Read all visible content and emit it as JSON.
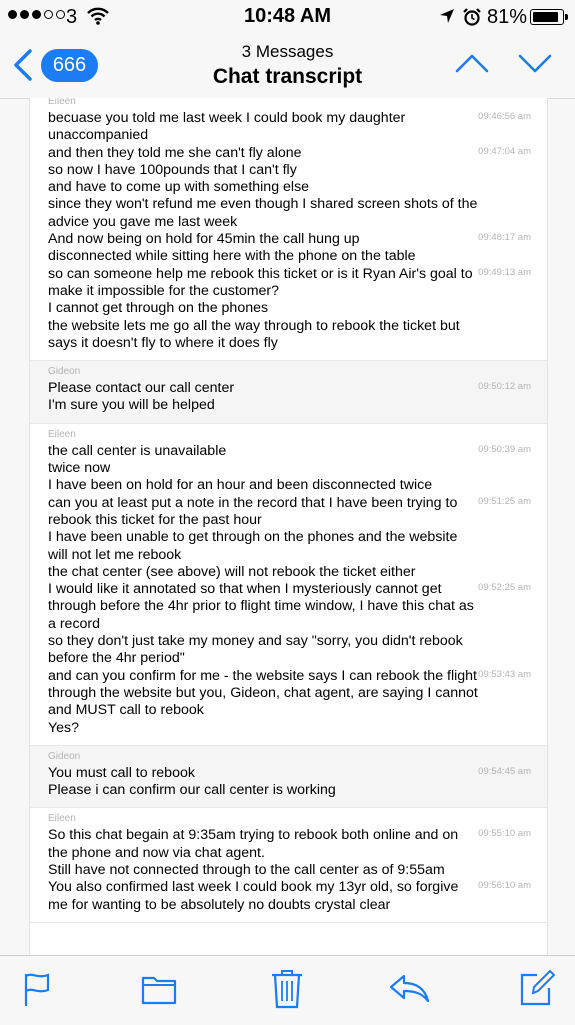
{
  "status_bar": {
    "carrier": "3",
    "time": "10:48 AM",
    "battery": "81%",
    "signal_bars_filled": 3,
    "signal_bars_total": 5
  },
  "nav": {
    "back_count": "666",
    "subtitle": "3 Messages",
    "title": "Chat transcript"
  },
  "colors": {
    "accent": "#1b7cf3"
  },
  "messages": [
    {
      "sender": "Eileen",
      "role": "customer",
      "lines": [
        {
          "text": "becuase you told me last week I could book my daughter unaccompanied",
          "time": "09:46:56 am"
        },
        {
          "text": "and then they told me she can't fly alone",
          "time": "09:47:04 am"
        },
        {
          "text": "so now I have 100pounds that I can't fly",
          "time": ""
        },
        {
          "text": "and have to come up with something else",
          "time": ""
        },
        {
          "text": "since they won't refund me even though I shared screen shots of the advice you gave me last week",
          "time": ""
        },
        {
          "text": "And now being on hold for 45min the call hung up",
          "time": "09:48:17 am"
        },
        {
          "text": "disconnected while sitting here with the phone on the table",
          "time": ""
        },
        {
          "text": "so can someone help me rebook this ticket or is it Ryan Air's goal to make it impossible for the customer?",
          "time": "09:49:13 am"
        },
        {
          "text": "I cannot get through on the phones",
          "time": ""
        },
        {
          "text": "the website lets me go all the way through to rebook the ticket but says it doesn't fly to where it does fly",
          "time": ""
        }
      ]
    },
    {
      "sender": "Gideon",
      "role": "agent",
      "lines": [
        {
          "text": "Please contact our call center",
          "time": "09:50:12 am"
        },
        {
          "text": "I'm sure you will be helped",
          "time": ""
        }
      ]
    },
    {
      "sender": "Eileen",
      "role": "customer",
      "lines": [
        {
          "text": "the call center is unavailable",
          "time": "09:50:39 am"
        },
        {
          "text": "twice now",
          "time": ""
        },
        {
          "text": "I have been on hold for an hour and been disconnected twice",
          "time": ""
        },
        {
          "text": "can you at least put a note in the record that I have been trying to rebook this ticket for the past hour",
          "time": "09:51:25 am"
        },
        {
          "text": "I have been unable to get through on the phones and the website will not let me rebook",
          "time": ""
        },
        {
          "text": "the chat center (see above) will not rebook the ticket either",
          "time": ""
        },
        {
          "text": "I would like it annotated so that when I mysteriously cannot get through before the 4hr prior to flight time window, I have this chat as a record",
          "time": "09:52:25 am"
        },
        {
          "text": "so they don't just take my money and say \"sorry, you didn't rebook before the 4hr period\"",
          "time": ""
        },
        {
          "text": "and can you confirm for me - the website says I can rebook the flight through the website but you, Gideon, chat agent, are saying I cannot and MUST call to rebook",
          "time": "09:53:43 am"
        },
        {
          "text": "Yes?",
          "time": ""
        }
      ]
    },
    {
      "sender": "Gideon",
      "role": "agent",
      "lines": [
        {
          "text": "You must call to rebook",
          "time": "09:54:45 am"
        },
        {
          "text": "Please i can confirm our call center is working",
          "time": ""
        }
      ]
    },
    {
      "sender": "Eileen",
      "role": "customer",
      "lines": [
        {
          "text": "So this chat begain at 9:35am trying to rebook both online and on the phone and now via chat agent.",
          "time": "09:55:10 am"
        },
        {
          "text": "Still have not connected through to the call center as of 9:55am",
          "time": ""
        },
        {
          "text": "You also confirmed last week I could book my 13yr old, so forgive me for wanting to be absolutely no doubts crystal clear",
          "time": "09:56:10 am"
        }
      ]
    }
  ],
  "toolbar": {
    "icons": [
      "flag-icon",
      "folder-icon",
      "trash-icon",
      "reply-icon",
      "compose-icon"
    ]
  }
}
